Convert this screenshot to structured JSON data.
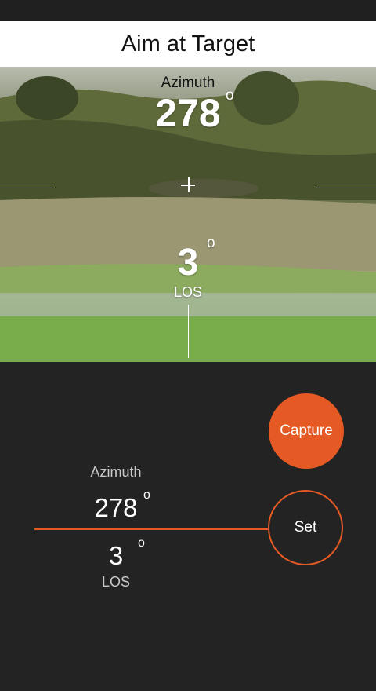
{
  "title": "Aim at Target",
  "overlay": {
    "azimuth_label": "Azimuth",
    "azimuth_value": "278",
    "azimuth_unit": "o",
    "los_value": "3",
    "los_unit": "o",
    "los_label": "LOS"
  },
  "readout": {
    "azimuth_label": "Azimuth",
    "azimuth_value": "278",
    "azimuth_unit": "o",
    "los_value": "3",
    "los_unit": "o",
    "los_label": "LOS"
  },
  "buttons": {
    "capture_label": "Capture",
    "set_label": "Set"
  },
  "colors": {
    "accent": "#e55a24",
    "background": "#232323",
    "title_bar": "#ffffff"
  }
}
